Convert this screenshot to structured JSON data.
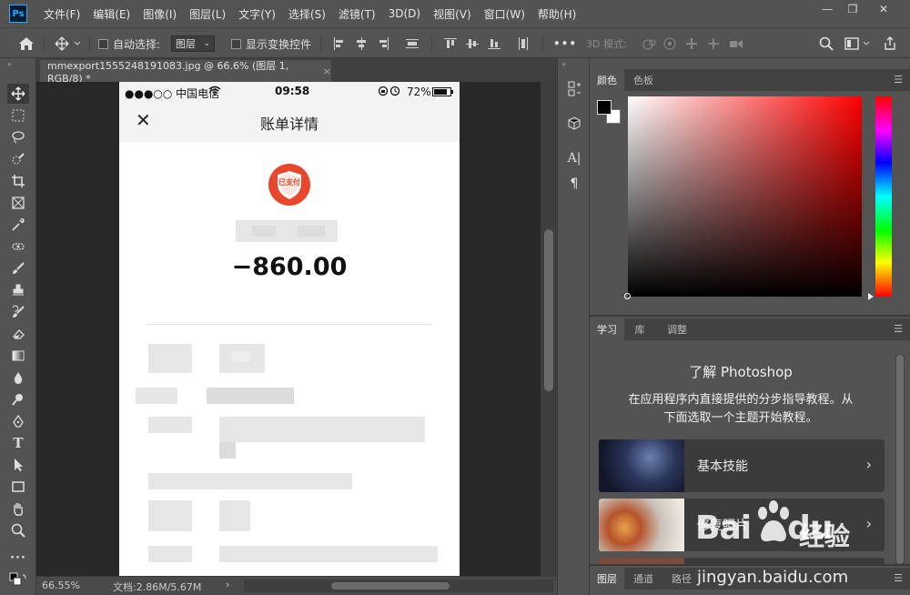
{
  "menubar": {
    "app_icon": "Ps",
    "items": [
      "文件(F)",
      "编辑(E)",
      "图像(I)",
      "图层(L)",
      "文字(Y)",
      "选择(S)",
      "滤镜(T)",
      "3D(D)",
      "视图(V)",
      "窗口(W)",
      "帮助(H)"
    ],
    "window_controls": [
      "—",
      "❐",
      "✕"
    ]
  },
  "options": {
    "auto_select_label": "自动选择:",
    "layer_dropdown": "图层",
    "show_transform_label": "显示变换控件",
    "more": "•••",
    "mode_3d_label": "3D 模式:"
  },
  "document": {
    "tab_title": "mmexport1555248191083.jpg @ 66.6% (图层 1, RGB/8) *",
    "tab_close": "×",
    "zoom": "66.55%",
    "doc_size": "文档:2.86M/5.67M",
    "arrow": "›"
  },
  "phone": {
    "carrier": "●●●○○ 中国电信",
    "wifi": "WiFi",
    "time": "09:58",
    "battery_percent": "72%",
    "close_glyph": "✕",
    "page_title": "账单详情",
    "logo_text": "已支付",
    "amount": "−860.00"
  },
  "color_panel": {
    "tabs": [
      "颜色",
      "色板"
    ],
    "fg_color": "#000000",
    "bg_color": "#ffffff"
  },
  "learn_panel": {
    "tabs": [
      "学习",
      "库",
      "调整"
    ],
    "title_prefix": "了解",
    "title_product": "Photoshop",
    "description_line1": "在应用程序内直接提供的分步指导教程。从",
    "description_line2": "下面选取一个主题开始教程。",
    "cards": [
      {
        "label": "基本技能"
      },
      {
        "label": "修复照片"
      }
    ]
  },
  "layers_panel": {
    "tabs": [
      "图层",
      "通道",
      "路径"
    ]
  },
  "watermark": {
    "brand": "Bai",
    "brand2": "du",
    "cn": "经验",
    "url": "jingyan.baidu.com"
  },
  "colors": {
    "ps_blue": "#31a8ff",
    "ui_gray": "#535353",
    "canvas_bg": "#282828"
  }
}
